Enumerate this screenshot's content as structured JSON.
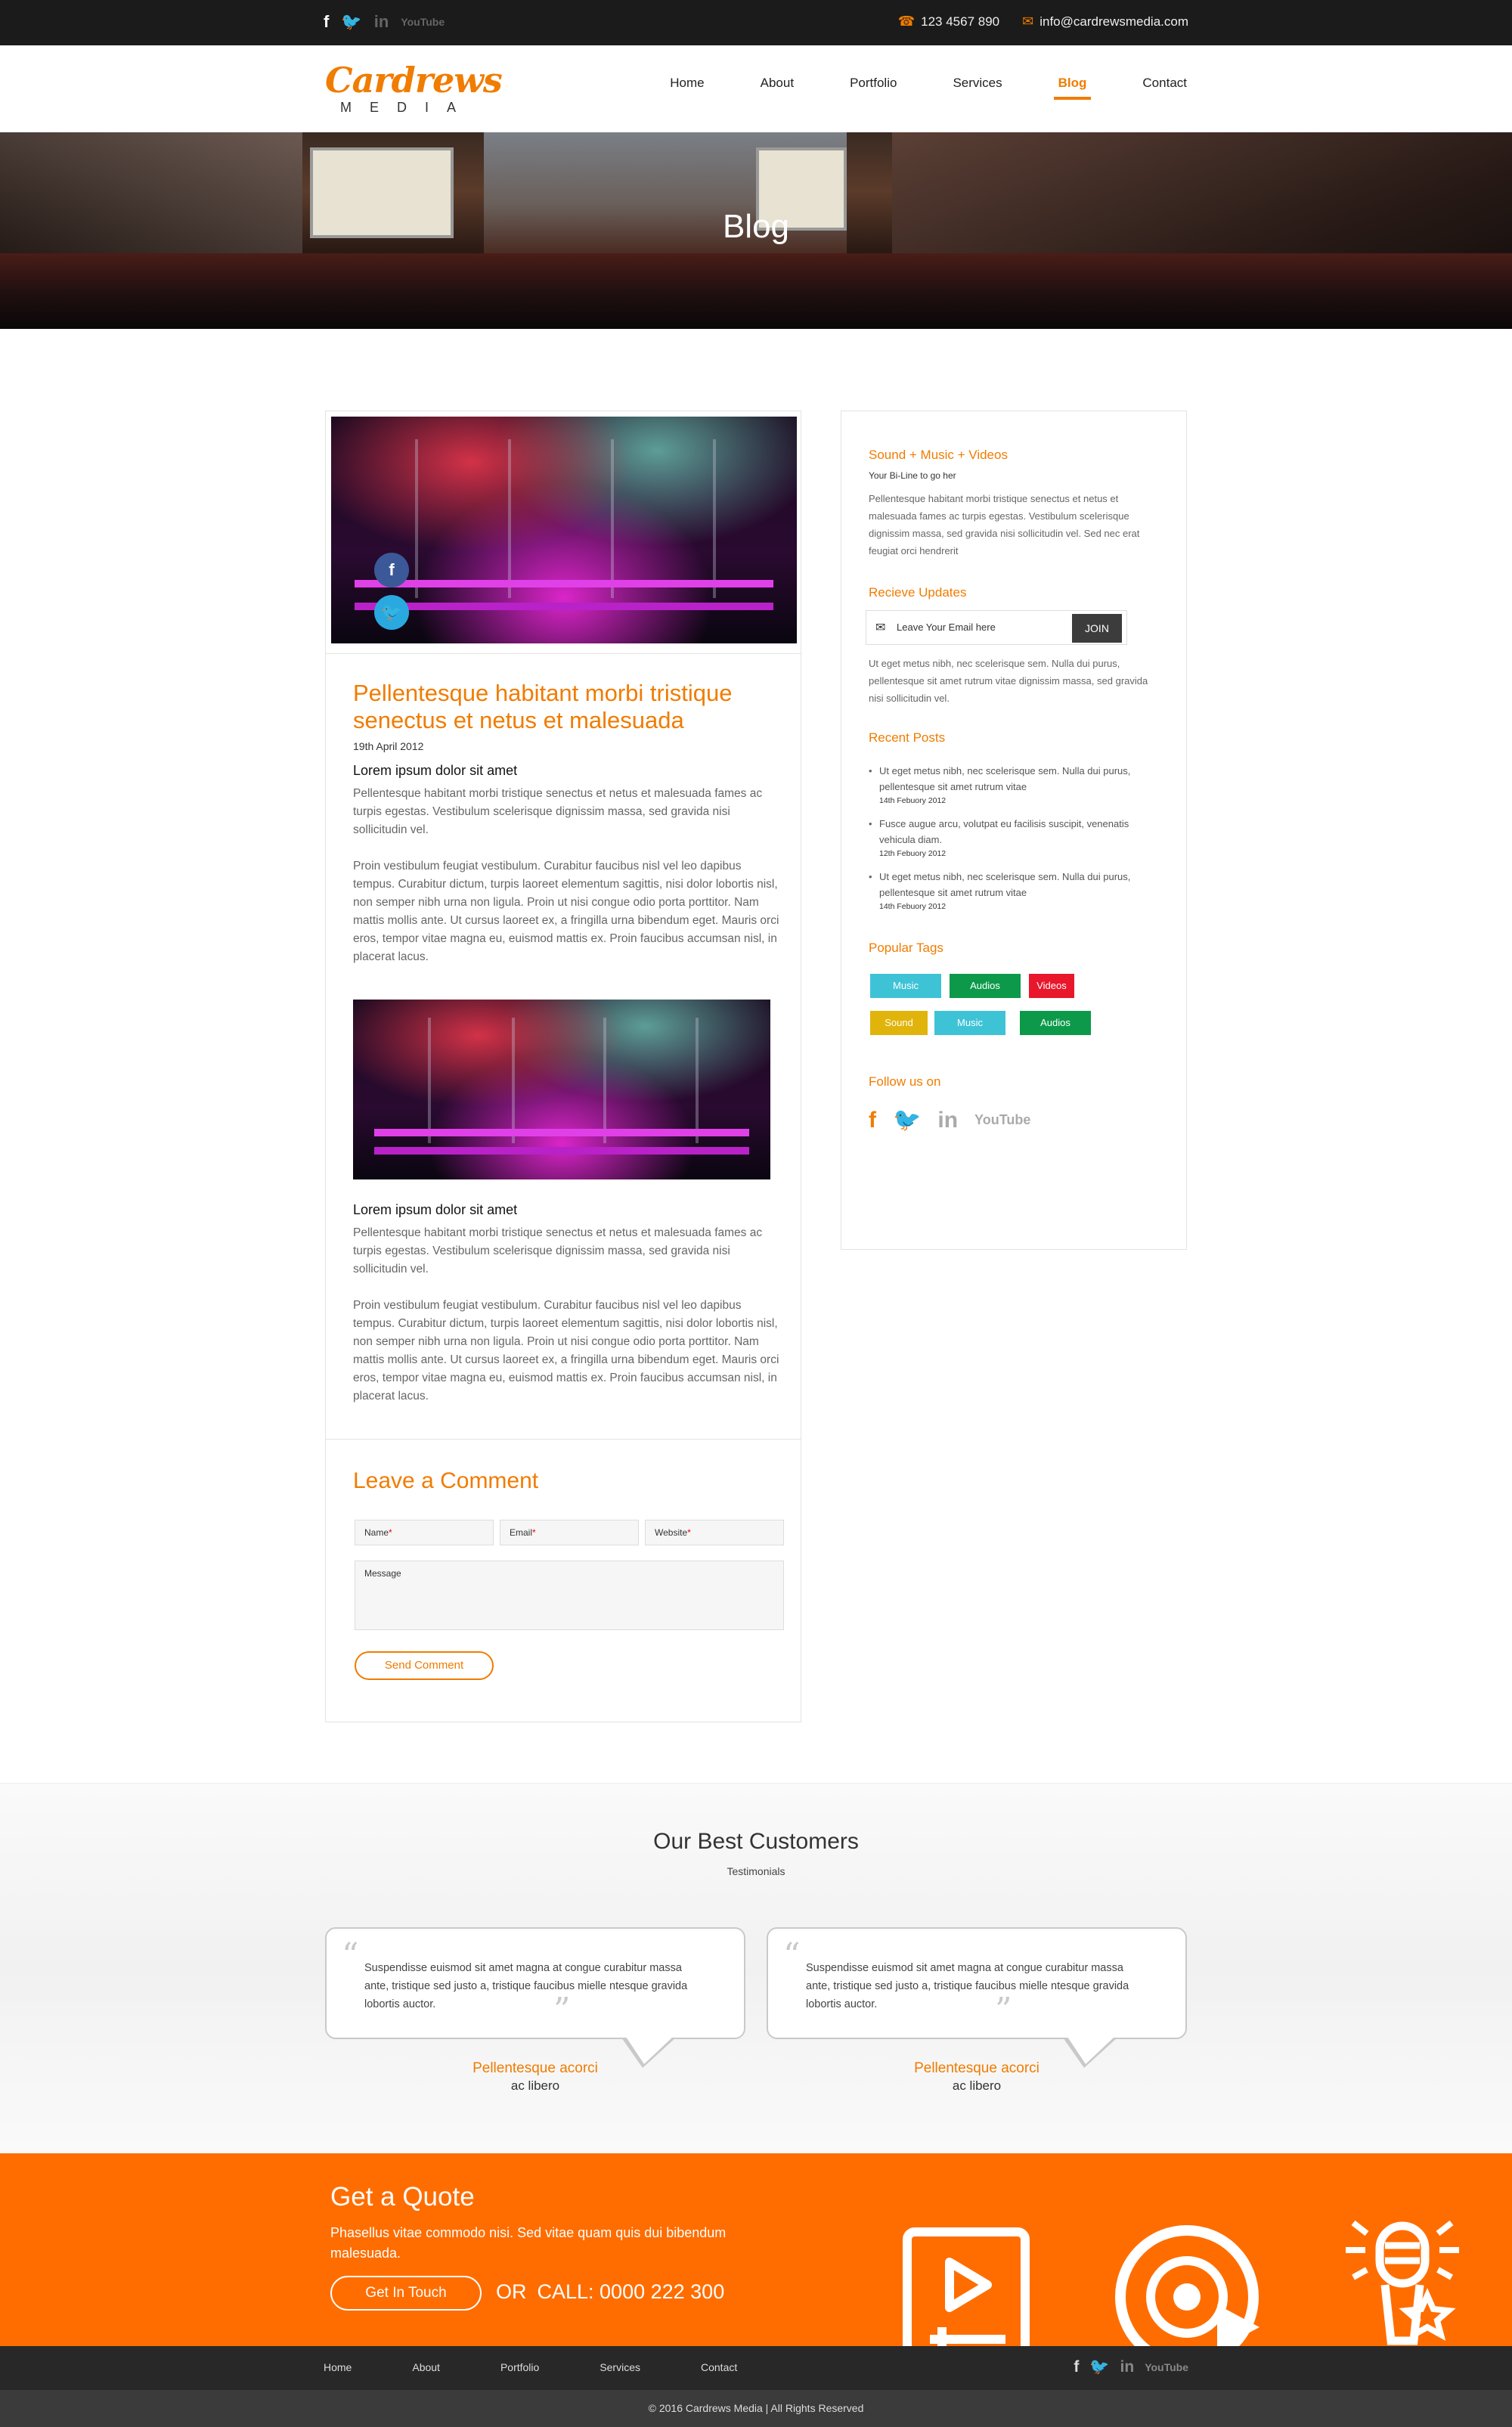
{
  "topbar": {
    "social": [
      "f",
      "🐦",
      "in",
      "YouTube"
    ],
    "phone": "123 4567 890",
    "email": "info@cardrewsmedia.com"
  },
  "header": {
    "logo_script": "Cardrews",
    "logo_media": "MEDIA",
    "nav": [
      {
        "label": "Home"
      },
      {
        "label": "About"
      },
      {
        "label": "Portfolio"
      },
      {
        "label": "Services"
      },
      {
        "label": "Blog",
        "active": true
      },
      {
        "label": "Contact"
      }
    ]
  },
  "hero": {
    "title": "Blog"
  },
  "post": {
    "title": "Pellentesque habitant morbi tristique senectus et netus et malesuada",
    "date": "19th April 2012",
    "section1_heading": "Lorem ipsum dolor sit amet",
    "section1_p1": "Pellentesque habitant morbi tristique senectus et netus et malesuada fames ac turpis egestas. Vestibulum scelerisque dignissim massa, sed gravida nisi sollicitudin vel.",
    "section1_p2": "Proin vestibulum feugiat vestibulum. Curabitur faucibus nisl vel leo dapibus tempus. Curabitur dictum, turpis laoreet elementum sagittis, nisi dolor lobortis nisl, non semper nibh urna non ligula. Proin ut nisi congue odio porta porttitor. Nam mattis mollis ante. Ut cursus laoreet ex, a fringilla urna bibendum eget. Mauris orci eros, tempor vitae magna eu, euismod mattis ex. Proin faucibus accumsan nisl, in placerat lacus.",
    "section2_heading": "Lorem ipsum dolor sit amet",
    "section2_p1": "Pellentesque habitant morbi tristique senectus et netus et malesuada fames ac turpis egestas. Vestibulum scelerisque dignissim massa, sed gravida nisi sollicitudin vel.",
    "section2_p2": "Proin vestibulum feugiat vestibulum. Curabitur faucibus nisl vel leo dapibus tempus. Curabitur dictum, turpis laoreet elementum sagittis, nisi dolor lobortis nisl, non semper nibh urna non ligula. Proin ut nisi congue odio porta porttitor. Nam mattis mollis ante. Ut cursus laoreet ex, a fringilla urna bibendum eget. Mauris orci eros, tempor vitae magna eu, euismod mattis ex. Proin faucibus accumsan nisl, in placerat lacus.",
    "share": {
      "facebook": "f",
      "twitter": "🐦"
    }
  },
  "comment": {
    "heading": "Leave a Comment",
    "name_label": "Name",
    "email_label": "Email",
    "website_label": "Website",
    "required_mark": "*",
    "message_label": "Message",
    "send_label": "Send Comment"
  },
  "sidebar": {
    "about_heading": "Sound + Music + Videos",
    "about_sub": "Your Bi-Line to go her",
    "about_text": "Pellentesque habitant morbi tristique senectus et netus et malesuada fames ac turpis egestas. Vestibulum scelerisque dignissim massa, sed gravida nisi sollicitudin vel. Sed nec erat feugiat orci hendrerit",
    "updates_heading": "Recieve Updates",
    "email_placeholder": "Leave Your Email here",
    "join_label": "JOIN",
    "updates_text": "Ut eget metus nibh, nec scelerisque sem. Nulla dui purus, pellentesque sit amet rutrum vitae dignissim massa, sed gravida nisi sollicitudin vel.",
    "recent_heading": "Recent Posts",
    "recent": [
      {
        "text": "Ut eget metus nibh, nec scelerisque sem. Nulla dui purus, pellentesque sit amet rutrum vitae",
        "date": "14th Febuory 2012"
      },
      {
        "text": "Fusce augue arcu, volutpat eu facilisis suscipit, venenatis vehicula diam.",
        "date": "12th Febuory 2012"
      },
      {
        "text": "Ut eget metus nibh, nec scelerisque sem. Nulla dui purus, pellentesque sit amet rutrum vitae",
        "date": "14th Febuory 2012"
      }
    ],
    "tags_heading": "Popular Tags",
    "tags": [
      {
        "label": "Music",
        "color": "#3ec3d6"
      },
      {
        "label": "Audios",
        "color": "#0c9a4a"
      },
      {
        "label": "Videos",
        "color": "#e8172c"
      },
      {
        "label": "Sound",
        "color": "#e0b40a"
      },
      {
        "label": "Music",
        "color": "#3ec3d6"
      },
      {
        "label": "Audios",
        "color": "#0c9a4a"
      }
    ],
    "follow_heading": "Follow us on",
    "follow": [
      "f",
      "🐦",
      "in",
      "YouTube"
    ]
  },
  "testimonials": {
    "heading": "Our Best Customers",
    "sub": "Testimonials",
    "items": [
      {
        "quote": "Suspendisse euismod sit amet magna at congue curabitur massa ante, tristique sed justo a, tristique faucibus mielle ntesque gravida lobortis auctor.",
        "name": "Pellentesque acorci",
        "role": "ac libero"
      },
      {
        "quote": "Suspendisse euismod sit amet magna at congue curabitur massa ante, tristique sed justo a, tristique faucibus mielle ntesque gravida lobortis auctor.",
        "name": "Pellentesque acorci",
        "role": "ac libero"
      }
    ]
  },
  "quote": {
    "heading": "Get a Quote",
    "text": "Phasellus vitae commodo nisi. Sed vitae quam quis dui bibendum malesuada.",
    "button": "Get In Touch",
    "or": "OR",
    "call": "CALL: 0000 222 300"
  },
  "footer": {
    "nav": [
      "Home",
      "About",
      "Portfolio",
      "Services",
      "Contact"
    ],
    "social": [
      "f",
      "🐦",
      "in",
      "YouTube"
    ],
    "copyright": "© 2016 Cardrews Media   |   All Rights Reserved"
  },
  "colors": {
    "accent": "#f07c00",
    "quote_band": "#ff6d00",
    "topbar": "#1b1b1b",
    "footer": "#282828"
  }
}
